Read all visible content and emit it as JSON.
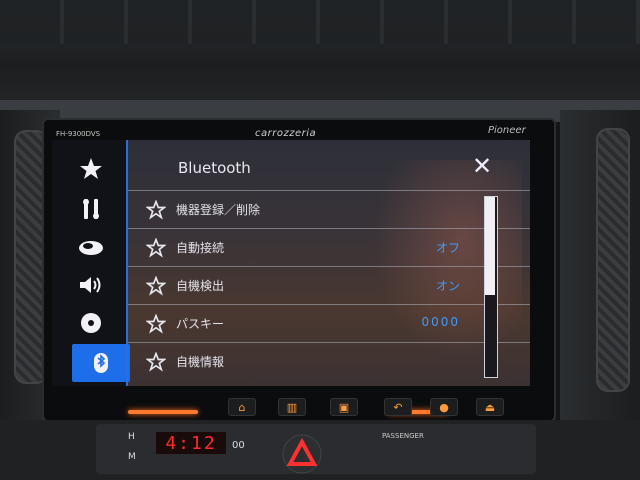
{
  "device": {
    "model": "FH-9300DVS",
    "brand": "carrozzeria",
    "maker": "Pioneer"
  },
  "screen": {
    "title": "Bluetooth",
    "close_label": "✕",
    "rows": [
      {
        "label": "機器登録／削除",
        "value": ""
      },
      {
        "label": "自動接続",
        "value": "オフ"
      },
      {
        "label": "自機検出",
        "value": "オン"
      },
      {
        "label": "パスキー",
        "value": "0000"
      },
      {
        "label": "自機情報",
        "value": ""
      }
    ],
    "scroll_fraction_visible": 0.55,
    "rail_icons": [
      "star-icon",
      "settings-tools-icon",
      "car-icon",
      "speaker-icon",
      "disc-icon",
      "bluetooth-icon"
    ],
    "active_rail": "bluetooth-icon"
  },
  "console": {
    "clock": "4:12",
    "hour_label": "H",
    "minute_label": "M",
    "small_display": "00",
    "passenger_label": "PASSENGER"
  },
  "colors": {
    "accent": "#1d6ee8",
    "value_text": "#3e9bff",
    "button_glow": "#ff7a2e"
  }
}
